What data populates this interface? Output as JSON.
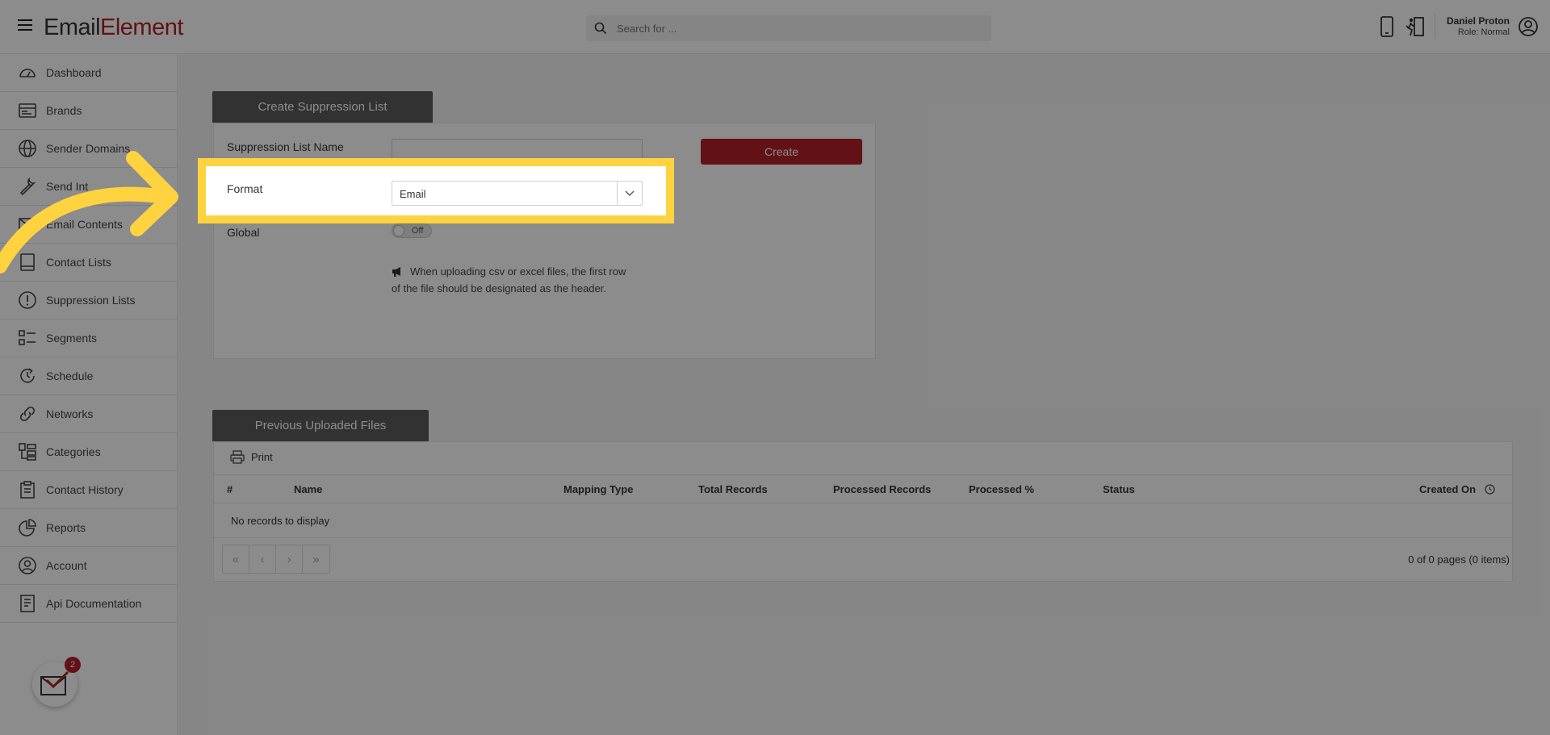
{
  "header": {
    "logo_e": "E",
    "logo_mail": "mail",
    "logo_element": "Element",
    "search_placeholder": "Search for ...",
    "user_name": "Daniel Proton",
    "user_role": "Role: Normal"
  },
  "sidebar": {
    "items": [
      {
        "label": "Dashboard",
        "icon": "gauge-icon"
      },
      {
        "label": "Brands",
        "icon": "id-card-icon"
      },
      {
        "label": "Sender Domains",
        "icon": "globe-icon"
      },
      {
        "label": "Send Int",
        "icon": "wrench-icon"
      },
      {
        "label": "Email Contents",
        "icon": "mail-icon"
      },
      {
        "label": "Contact Lists",
        "icon": "book-icon"
      },
      {
        "label": "Suppression Lists",
        "icon": "alert-circle-icon"
      },
      {
        "label": "Segments",
        "icon": "list-icon"
      },
      {
        "label": "Schedule",
        "icon": "clock-icon"
      },
      {
        "label": "Networks",
        "icon": "link-icon"
      },
      {
        "label": "Categories",
        "icon": "categories-icon"
      },
      {
        "label": "Contact History",
        "icon": "clipboard-icon"
      },
      {
        "label": "Reports",
        "icon": "pie-chart-icon"
      },
      {
        "label": "Account",
        "icon": "user-circle-icon"
      },
      {
        "label": "Api Documentation",
        "icon": "document-icon"
      }
    ],
    "fab_badge": "2"
  },
  "create_panel": {
    "tab_title": "Create Suppression List",
    "name_label": "Suppression List Name",
    "name_value": "",
    "format_label": "Format",
    "format_value": "Email",
    "global_label": "Global",
    "global_toggle": "Off",
    "create_button": "Create",
    "note": "When uploading csv or excel files, the first row of the file should be designated as the header."
  },
  "files_panel": {
    "tab_title": "Previous Uploaded Files",
    "print_label": "Print",
    "columns": [
      "#",
      "Name",
      "Mapping Type",
      "Total Records",
      "Processed Records",
      "Processed %",
      "Status",
      "Created On"
    ],
    "empty_text": "No records to display",
    "pager": {
      "first": "«",
      "prev": "‹",
      "next": "›",
      "last": "»"
    },
    "page_info": "0 of 0 pages (0 items)"
  },
  "colors": {
    "brand": "#b31f2a",
    "highlight": "#ffd23f",
    "tab_bg": "#5b5b5b"
  }
}
